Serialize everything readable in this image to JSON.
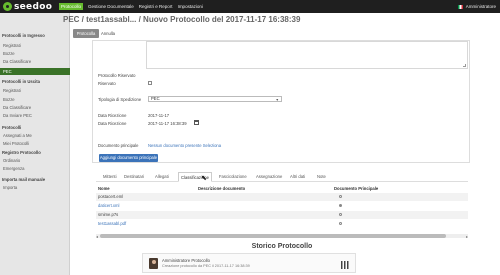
{
  "app": {
    "logo_text": "seedoo",
    "accent": "#66bb2e",
    "topbar_bg": "#1f1f1f",
    "sidebar_active_bg": "#3a7228",
    "link": "#3b73b9"
  },
  "topnav": {
    "items": [
      {
        "label": "Protocollo",
        "active": true
      },
      {
        "label": "Gestione Documentale",
        "active": false
      },
      {
        "label": "Registri e Report",
        "active": false
      },
      {
        "label": "Impostazioni",
        "active": false
      }
    ],
    "user": "Amministratore"
  },
  "page": {
    "title": "PEC / test1assabl... / Nuovo Protocollo del 2017-11-17 16:38:39"
  },
  "sidebar": {
    "items": [
      {
        "label": "Protocolli in Ingresso",
        "kind": "head"
      },
      {
        "label": "Registrati",
        "kind": "item"
      },
      {
        "label": "Bozze",
        "kind": "item"
      },
      {
        "label": "Da Classificare",
        "kind": "item"
      },
      {
        "label": "PEC",
        "kind": "active"
      },
      {
        "label": "Protocolli in Uscita",
        "kind": "head"
      },
      {
        "label": "Registrati",
        "kind": "item"
      },
      {
        "label": "Bozze",
        "kind": "item"
      },
      {
        "label": "Da Classificare",
        "kind": "item"
      },
      {
        "label": "Da Inviare PEC",
        "kind": "item"
      },
      {
        "label": "Protocolli",
        "kind": "head"
      },
      {
        "label": "Assegnati a Me",
        "kind": "item"
      },
      {
        "label": "Miei Protocolli",
        "kind": "item"
      },
      {
        "label": "Registro Protocollo",
        "kind": "head"
      },
      {
        "label": "Ordinario",
        "kind": "item"
      },
      {
        "label": "Emergenza",
        "kind": "item"
      },
      {
        "label": "Importa mail manuale",
        "kind": "head"
      },
      {
        "label": "Importa",
        "kind": "item"
      }
    ]
  },
  "toolbar": {
    "back_label": "Protocolla",
    "cancel_label": "Annulla"
  },
  "form": {
    "oggetto_label": "Protocollo Riservato",
    "riservato_label": "Riservato",
    "tipologia_label": "Tipologia di Spedizione",
    "tipologia_value": "PEC",
    "data_ricezione_label": "Data Ricezione",
    "data_ricezione_value": "2017-11-17",
    "data_ricezione_ora_label": "Data Ricezione",
    "data_ricezione_ora_value": "2017-11-17 16:38:39",
    "documento_label": "Documento principale",
    "documento_value": "Nessun documento presente Seleziona",
    "upload_label": "Aggiungi documento principale"
  },
  "tabs": [
    {
      "label": "Mittenti",
      "active": false
    },
    {
      "label": "Destinatari",
      "active": false
    },
    {
      "label": "Allegati",
      "active": false
    },
    {
      "label": "Classificazione",
      "active": true
    },
    {
      "label": "Fascicolazione",
      "active": false
    },
    {
      "label": "Assegnazione",
      "active": false
    },
    {
      "label": "Altri dati",
      "active": false
    },
    {
      "label": "Note",
      "active": false
    }
  ],
  "table": {
    "headers": [
      "Nome",
      "Descrizione documento",
      "Documento Principale"
    ],
    "rows": [
      {
        "name": "postacert.eml",
        "link": false,
        "principale": false
      },
      {
        "name": "daticert.xml",
        "link": true,
        "principale": true
      },
      {
        "name": "smime.p7s",
        "link": false,
        "principale": false
      },
      {
        "name": "test1assabl.pdf",
        "link": true,
        "principale": false
      }
    ]
  },
  "storico": {
    "title": "Storico Protocollo",
    "entries": [
      {
        "name": "Amministratore Protocollo",
        "desc": "Creazione protocollo da PEC il 2017-11-17 16:38:39"
      }
    ]
  }
}
